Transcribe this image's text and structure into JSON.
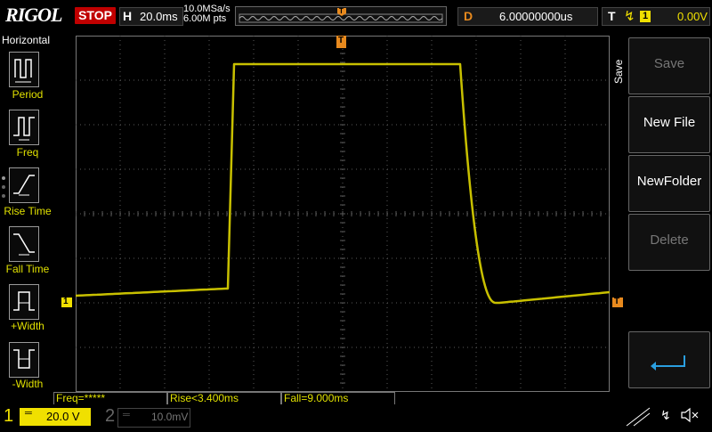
{
  "header": {
    "logo": "RIGOL",
    "run_state": "STOP",
    "timebase_label": "H",
    "timebase_value": "20.0ms",
    "sample_rate": "10.0MSa/s",
    "memory_depth": "6.00M pts",
    "trigger_pos_marker": "T",
    "delay_label": "D",
    "delay_value": "6.00000000us",
    "trigger_label": "T",
    "trigger_channel": "1",
    "trigger_level": "0.00V"
  },
  "left_panel": {
    "title": "Horizontal",
    "items": [
      {
        "label": "Period",
        "icon": "period-icon"
      },
      {
        "label": "Freq",
        "icon": "freq-icon"
      },
      {
        "label": "Rise Time",
        "icon": "rise-time-icon"
      },
      {
        "label": "Fall Time",
        "icon": "fall-time-icon"
      },
      {
        "label": "+Width",
        "icon": "pos-width-icon"
      },
      {
        "label": "-Width",
        "icon": "neg-width-icon"
      }
    ]
  },
  "menu": {
    "title": "Save",
    "keys": [
      {
        "label": "Save",
        "enabled": false
      },
      {
        "label": "New File",
        "enabled": true
      },
      {
        "label": "NewFolder",
        "enabled": true
      },
      {
        "label": "Delete",
        "enabled": false
      },
      {
        "label": "",
        "icon": "return-arrow-icon"
      }
    ]
  },
  "measurements": [
    {
      "text": "Freq=*****"
    },
    {
      "text": "Rise<3.400ms"
    },
    {
      "text": "Fall=9.000ms"
    }
  ],
  "channels": {
    "ch1": {
      "number": "1",
      "coupling": "⎓",
      "scale": "20.0 V",
      "color": "#f0e000"
    },
    "ch2": {
      "number": "2",
      "scale": "10.0mV",
      "color": "#00a0c0"
    }
  },
  "markers": {
    "ch1_level": "1",
    "trigger_level": "T",
    "trigger_top": "T"
  },
  "status_icons": [
    "usb-icon",
    "mute-icon"
  ],
  "colors": {
    "trace": "#c8c000",
    "grid": "#5a5a5a",
    "trigger_marker": "#e88a1e"
  }
}
